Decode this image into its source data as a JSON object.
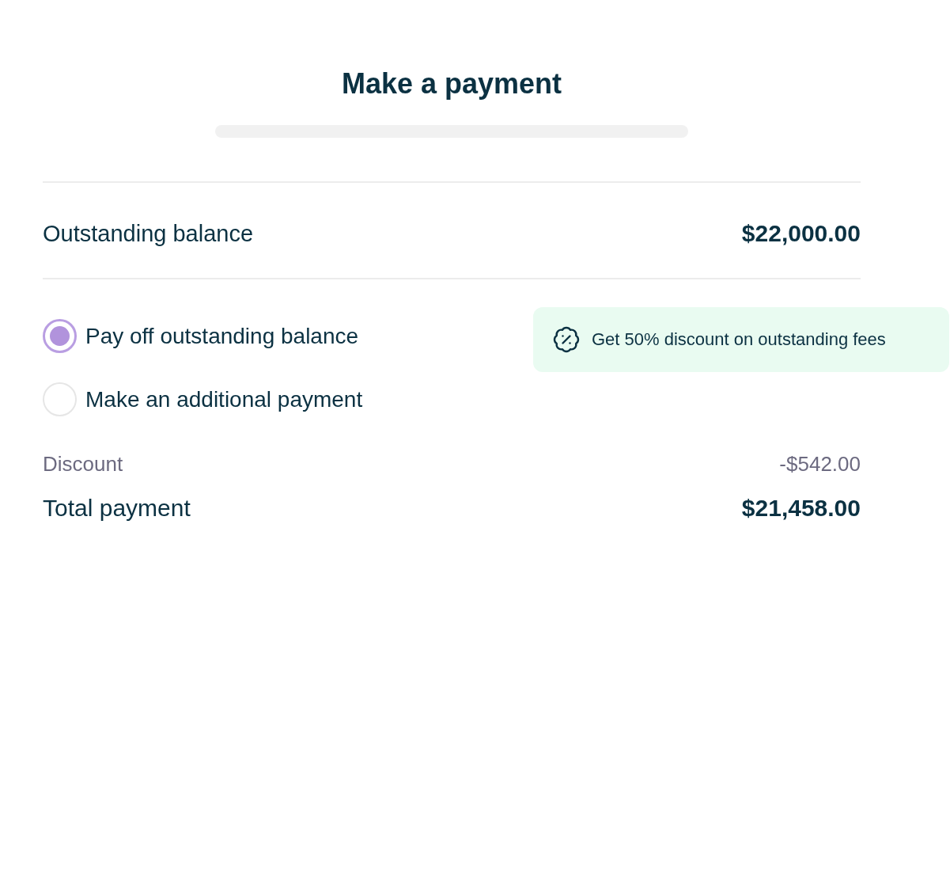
{
  "header": {
    "title": "Make a payment"
  },
  "balance": {
    "label": "Outstanding balance",
    "value": "$22,000.00"
  },
  "options": [
    {
      "label": "Pay off outstanding balance",
      "selected": true
    },
    {
      "label": "Make an additional payment",
      "selected": false
    }
  ],
  "promo": {
    "text": "Get 50% discount on outstanding fees"
  },
  "summary": [
    {
      "kind": "muted",
      "label": "Discount",
      "value": "-$542.00"
    },
    {
      "kind": "total",
      "label": "Total payment",
      "value": "$21,458.00"
    }
  ]
}
